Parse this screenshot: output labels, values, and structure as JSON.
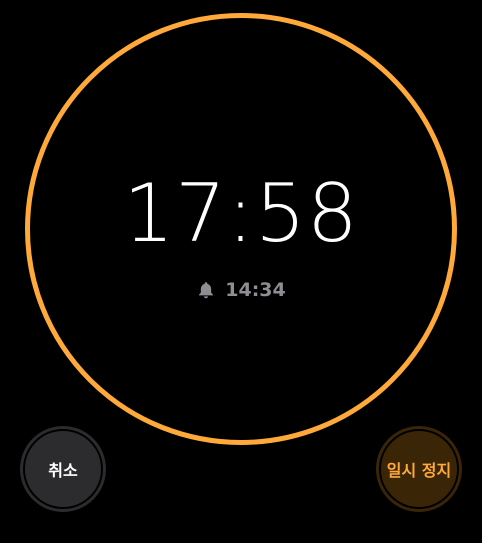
{
  "timer": {
    "remaining": "17:58",
    "end_time": "14:34",
    "end_icon": "bell-icon",
    "ring_progress": 1.0
  },
  "buttons": {
    "cancel_label": "취소",
    "pause_label": "일시 정지"
  },
  "colors": {
    "accent": "#FFA93A",
    "background": "#000000",
    "secondary_text": "#8E8E93",
    "cancel_bg": "#2C2C2E",
    "pause_bg": "#3A2507"
  }
}
